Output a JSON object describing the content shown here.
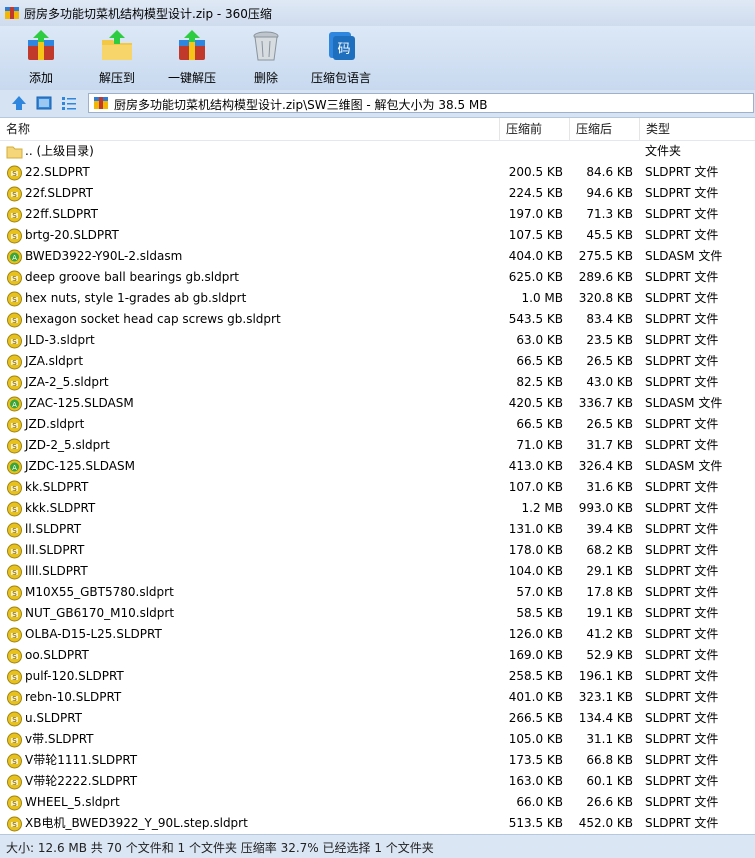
{
  "window": {
    "title": "厨房多功能切菜机结构模型设计.zip - 360压缩"
  },
  "toolbar": {
    "buttons": [
      {
        "label": "添加",
        "icon": "add-archive-icon"
      },
      {
        "label": "解压到",
        "icon": "extract-to-icon"
      },
      {
        "label": "一键解压",
        "icon": "one-click-extract-icon"
      },
      {
        "label": "删除",
        "icon": "delete-bin-icon"
      },
      {
        "label": "压缩包语言",
        "icon": "archive-language-icon"
      }
    ]
  },
  "address": {
    "path": "厨房多功能切菜机结构模型设计.zip\\SW三维图 - 解包大小为 38.5 MB"
  },
  "columns": {
    "name": "名称",
    "before": "压缩前",
    "after": "压缩后",
    "type": "类型"
  },
  "files": [
    {
      "name": ".. (上级目录)",
      "before": "",
      "after": "",
      "type": "文件夹",
      "kind": "folder"
    },
    {
      "name": "22.SLDPRT",
      "before": "200.5 KB",
      "after": "84.6 KB",
      "type": "SLDPRT 文件",
      "kind": "part"
    },
    {
      "name": "22f.SLDPRT",
      "before": "224.5 KB",
      "after": "94.6 KB",
      "type": "SLDPRT 文件",
      "kind": "part"
    },
    {
      "name": "22ff.SLDPRT",
      "before": "197.0 KB",
      "after": "71.3 KB",
      "type": "SLDPRT 文件",
      "kind": "part"
    },
    {
      "name": "brtg-20.SLDPRT",
      "before": "107.5 KB",
      "after": "45.5 KB",
      "type": "SLDPRT 文件",
      "kind": "part"
    },
    {
      "name": "BWED3922-Y90L-2.sldasm",
      "before": "404.0 KB",
      "after": "275.5 KB",
      "type": "SLDASM 文件",
      "kind": "asm"
    },
    {
      "name": "deep groove ball bearings gb.sldprt",
      "before": "625.0 KB",
      "after": "289.6 KB",
      "type": "SLDPRT 文件",
      "kind": "part"
    },
    {
      "name": "hex nuts, style 1-grades ab gb.sldprt",
      "before": "1.0 MB",
      "after": "320.8 KB",
      "type": "SLDPRT 文件",
      "kind": "part"
    },
    {
      "name": "hexagon socket head cap screws gb.sldprt",
      "before": "543.5 KB",
      "after": "83.4 KB",
      "type": "SLDPRT 文件",
      "kind": "part"
    },
    {
      "name": "JLD-3.sldprt",
      "before": "63.0 KB",
      "after": "23.5 KB",
      "type": "SLDPRT 文件",
      "kind": "part"
    },
    {
      "name": "JZA.sldprt",
      "before": "66.5 KB",
      "after": "26.5 KB",
      "type": "SLDPRT 文件",
      "kind": "part"
    },
    {
      "name": "JZA-2_5.sldprt",
      "before": "82.5 KB",
      "after": "43.0 KB",
      "type": "SLDPRT 文件",
      "kind": "part"
    },
    {
      "name": "JZAC-125.SLDASM",
      "before": "420.5 KB",
      "after": "336.7 KB",
      "type": "SLDASM 文件",
      "kind": "asm"
    },
    {
      "name": "JZD.sldprt",
      "before": "66.5 KB",
      "after": "26.5 KB",
      "type": "SLDPRT 文件",
      "kind": "part"
    },
    {
      "name": "JZD-2_5.sldprt",
      "before": "71.0 KB",
      "after": "31.7 KB",
      "type": "SLDPRT 文件",
      "kind": "part"
    },
    {
      "name": "JZDC-125.SLDASM",
      "before": "413.0 KB",
      "after": "326.4 KB",
      "type": "SLDASM 文件",
      "kind": "asm"
    },
    {
      "name": "kk.SLDPRT",
      "before": "107.0 KB",
      "after": "31.6 KB",
      "type": "SLDPRT 文件",
      "kind": "part"
    },
    {
      "name": "kkk.SLDPRT",
      "before": "1.2 MB",
      "after": "993.0 KB",
      "type": "SLDPRT 文件",
      "kind": "part"
    },
    {
      "name": "ll.SLDPRT",
      "before": "131.0 KB",
      "after": "39.4 KB",
      "type": "SLDPRT 文件",
      "kind": "part"
    },
    {
      "name": "lll.SLDPRT",
      "before": "178.0 KB",
      "after": "68.2 KB",
      "type": "SLDPRT 文件",
      "kind": "part"
    },
    {
      "name": "llll.SLDPRT",
      "before": "104.0 KB",
      "after": "29.1 KB",
      "type": "SLDPRT 文件",
      "kind": "part"
    },
    {
      "name": "M10X55_GBT5780.sldprt",
      "before": "57.0 KB",
      "after": "17.8 KB",
      "type": "SLDPRT 文件",
      "kind": "part"
    },
    {
      "name": "NUT_GB6170_M10.sldprt",
      "before": "58.5 KB",
      "after": "19.1 KB",
      "type": "SLDPRT 文件",
      "kind": "part"
    },
    {
      "name": "OLBA-D15-L25.SLDPRT",
      "before": "126.0 KB",
      "after": "41.2 KB",
      "type": "SLDPRT 文件",
      "kind": "part"
    },
    {
      "name": "oo.SLDPRT",
      "before": "169.0 KB",
      "after": "52.9 KB",
      "type": "SLDPRT 文件",
      "kind": "part"
    },
    {
      "name": "pulf-120.SLDPRT",
      "before": "258.5 KB",
      "after": "196.1 KB",
      "type": "SLDPRT 文件",
      "kind": "part"
    },
    {
      "name": "rebn-10.SLDPRT",
      "before": "401.0 KB",
      "after": "323.1 KB",
      "type": "SLDPRT 文件",
      "kind": "part"
    },
    {
      "name": "u.SLDPRT",
      "before": "266.5 KB",
      "after": "134.4 KB",
      "type": "SLDPRT 文件",
      "kind": "part"
    },
    {
      "name": "v带.SLDPRT",
      "before": "105.0 KB",
      "after": "31.1 KB",
      "type": "SLDPRT 文件",
      "kind": "part"
    },
    {
      "name": "V带轮1111.SLDPRT",
      "before": "173.5 KB",
      "after": "66.8 KB",
      "type": "SLDPRT 文件",
      "kind": "part"
    },
    {
      "name": "V带轮2222.SLDPRT",
      "before": "163.0 KB",
      "after": "60.1 KB",
      "type": "SLDPRT 文件",
      "kind": "part"
    },
    {
      "name": "WHEEL_5.sldprt",
      "before": "66.0 KB",
      "after": "26.6 KB",
      "type": "SLDPRT 文件",
      "kind": "part"
    },
    {
      "name": "XB电机_BWED3922_Y_90L.step.sldprt",
      "before": "513.5 KB",
      "after": "452.0 KB",
      "type": "SLDPRT 文件",
      "kind": "part"
    }
  ],
  "status": {
    "text": "大小: 12.6 MB 共 70 个文件和 1 个文件夹 压缩率 32.7% 已经选择 1 个文件夹"
  },
  "colors": {
    "toolbar_bg": "#c8d9ef",
    "status_bg": "#dbe6f4",
    "part_icon": "#e7c21f",
    "asm_icon": "#3aa53a"
  }
}
